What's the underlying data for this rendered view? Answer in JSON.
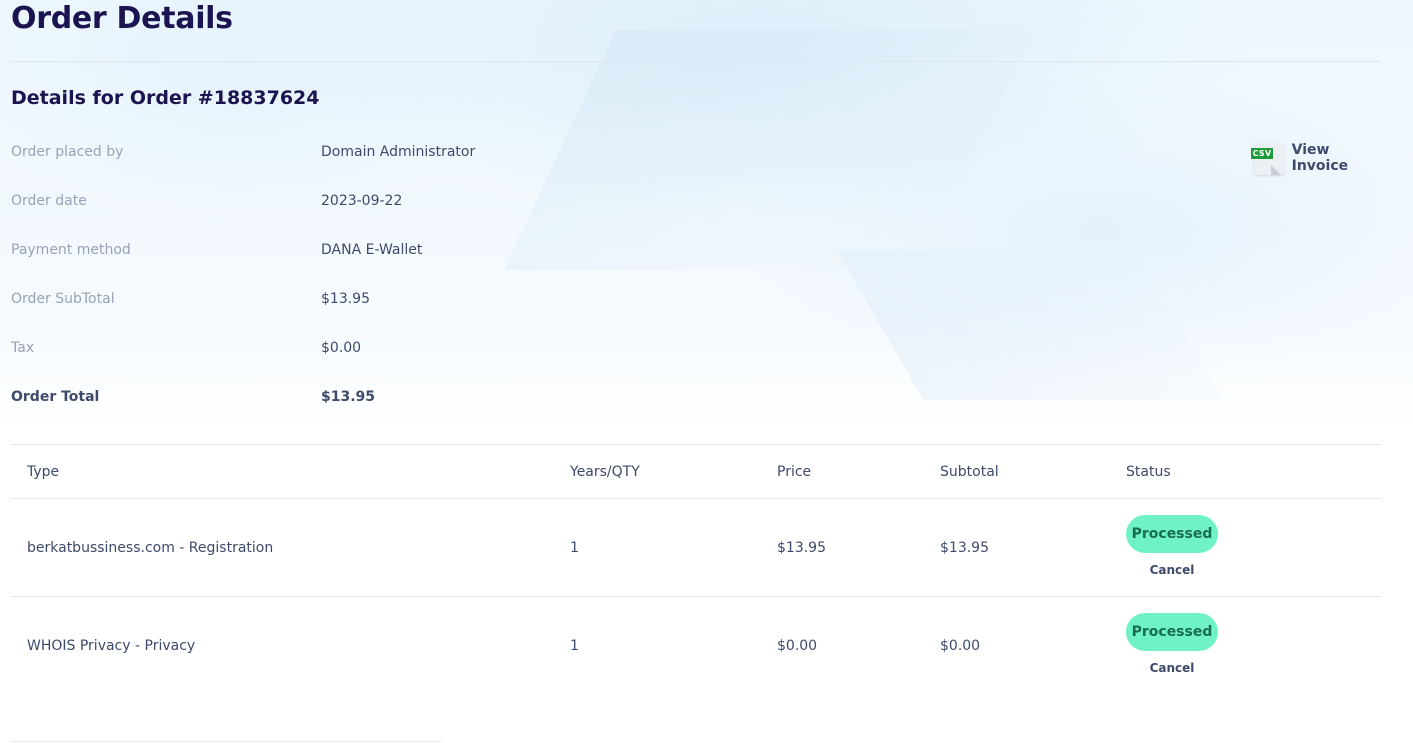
{
  "page": {
    "title": "Order Details",
    "section_title": "Details for Order #18837624"
  },
  "details": [
    {
      "label": "Order placed by",
      "value": "Domain Administrator"
    },
    {
      "label": "Order date",
      "value": "2023-09-22"
    },
    {
      "label": "Payment method",
      "value": "DANA E-Wallet"
    },
    {
      "label": "Order SubTotal",
      "value": "$13.95"
    },
    {
      "label": "Tax",
      "value": "$0.00"
    },
    {
      "label": "Order Total",
      "value": "$13.95"
    }
  ],
  "invoice": {
    "icon": "csv-file-icon",
    "badge": "CSV",
    "label": "View Invoice",
    "badge_color": "#1f9a3a"
  },
  "table": {
    "headers": {
      "type": "Type",
      "qty": "Years/QTY",
      "price": "Price",
      "subtotal": "Subtotal",
      "status": "Status"
    },
    "rows": [
      {
        "type": "berkatbussiness.com - Registration",
        "qty": "1",
        "price": "$13.95",
        "subtotal": "$13.95",
        "status": "Processed",
        "action": "Cancel"
      },
      {
        "type": "WHOIS Privacy - Privacy",
        "qty": "1",
        "price": "$0.00",
        "subtotal": "$0.00",
        "status": "Processed",
        "action": "Cancel"
      }
    ]
  },
  "colors": {
    "title": "#1b1450",
    "text": "#3e4a6b",
    "label": "#98a2b6",
    "status_pill": "#6ff2c6"
  }
}
